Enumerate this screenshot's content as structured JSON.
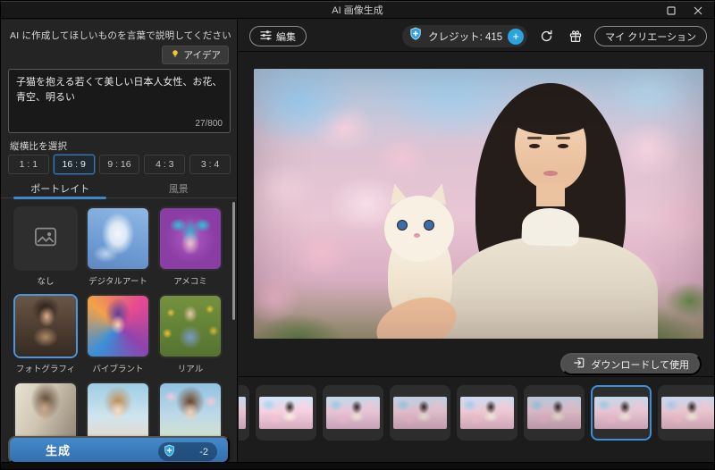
{
  "titlebar": {
    "title": "AI 画像生成"
  },
  "left_panel": {
    "prompt_label": "AI に作成してほしいものを言葉で説明してください",
    "idea_button": "アイデア",
    "prompt_value": "子猫を抱える若くて美しい日本人女性、お花、青空、明るい",
    "char_counter": "27/800",
    "ratio_label": "縦横比を選択",
    "ratios": [
      {
        "label": "1 : 1",
        "selected": false
      },
      {
        "label": "16 : 9",
        "selected": true
      },
      {
        "label": "9 : 16",
        "selected": false
      },
      {
        "label": "4 : 3",
        "selected": false
      },
      {
        "label": "3 : 4",
        "selected": false
      }
    ],
    "tabs": [
      {
        "label": "ポートレイト",
        "selected": true
      },
      {
        "label": "風景",
        "selected": false
      }
    ],
    "styles": [
      {
        "label": "なし",
        "selected": false
      },
      {
        "label": "デジタルアート",
        "selected": false
      },
      {
        "label": "アメコミ",
        "selected": false
      },
      {
        "label": "フォトグラフィ",
        "selected": true
      },
      {
        "label": "バイブラント",
        "selected": false
      },
      {
        "label": "リアル",
        "selected": false
      }
    ],
    "generate": {
      "label": "生成",
      "cost": "-2"
    }
  },
  "toolbar": {
    "edit_button": "編集",
    "credits_label": "クレジット: 415",
    "my_creations_button": "マイ クリエーション"
  },
  "main": {
    "download_button": "ダウンロードして使用",
    "filmstrip": {
      "total_items": 8,
      "selected_index": 6
    }
  },
  "colors": {
    "accent_blue": "#3f87c9",
    "selected_border": "#4a97e0",
    "generate_blue": "#3c7fc0",
    "credit_plus": "#2ba3dc"
  }
}
